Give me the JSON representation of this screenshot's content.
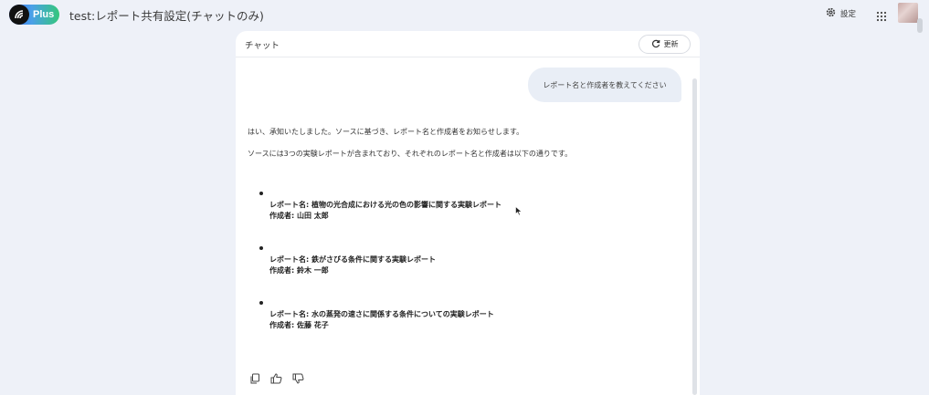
{
  "header": {
    "badge_label": "Plus",
    "title": "test:レポート共有設定(チャットのみ)",
    "settings_label": "設定"
  },
  "chat": {
    "panel_title": "チャット",
    "refresh_label": "更新",
    "user_message": "レポート名と作成者を教えてください",
    "response": {
      "intro": "はい、承知いたしました。ソースに基づき、レポート名と作成者をお知らせします。",
      "summary": "ソースには3つの実験レポートが含まれており、それぞれのレポート名と作成者は以下の通りです。",
      "items": [
        {
          "report": "レポート名: 植物の光合成における光の色の影響に関する実験レポート",
          "author": "作成者: 山田 太郎"
        },
        {
          "report": "レポート名: 鉄がさびる条件に関する実験レポート",
          "author": "作成者: 鈴木 一郎"
        },
        {
          "report": "レポート名: 水の蒸発の速さに関係する条件についての実験レポート",
          "author": "作成者: 佐藤 花子"
        }
      ]
    },
    "actions": [
      "copy-icon",
      "thumbs-up-icon",
      "thumbs-down-icon"
    ]
  },
  "colors": {
    "background": "#eef1f8",
    "badge_gradient_start": "#3a6cf4",
    "badge_gradient_end": "#34c77b",
    "user_bubble": "#e9eef6"
  }
}
